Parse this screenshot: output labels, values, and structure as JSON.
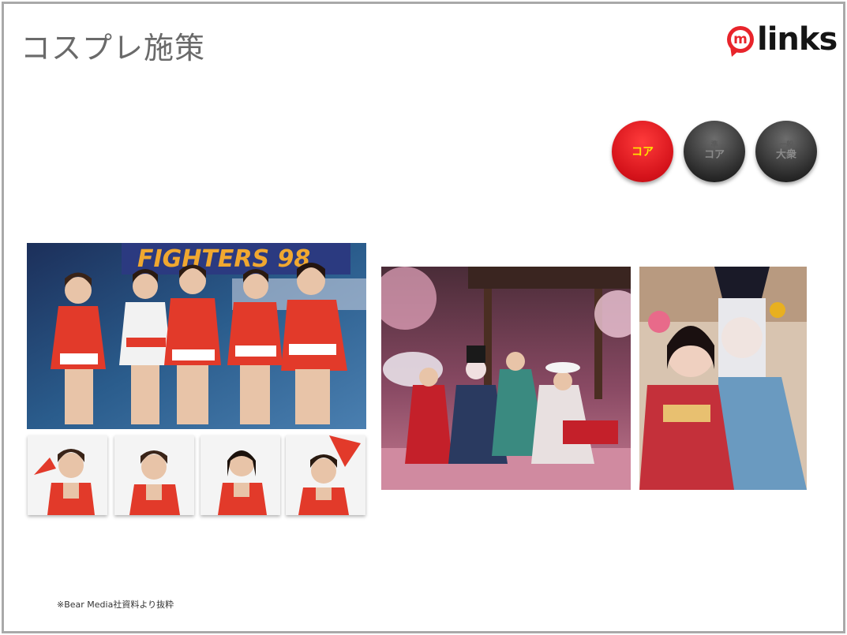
{
  "slide": {
    "title": "コスプレ施策",
    "footnote": "※Bear Media社資料より抜粋"
  },
  "logo": {
    "mark_letter": "m",
    "text": "links",
    "icon": "speech-bubble-m-icon",
    "color": "#e8242b"
  },
  "badges": [
    {
      "label": "コア",
      "sub": "",
      "active": true,
      "color": "#d4121a",
      "text_color": "#ffe600"
    },
    {
      "label": "コア",
      "sub": "準",
      "active": false,
      "color": "#2a2a2a"
    },
    {
      "label": "大衆",
      "sub": "一般",
      "active": false,
      "color": "#2a2a2a"
    }
  ],
  "photos": {
    "group_stage": "group-cosplay-stage-photo",
    "thumbs": [
      "cosplayer-thumb-1",
      "cosplayer-thumb-2",
      "cosplayer-thumb-3",
      "cosplayer-thumb-4"
    ],
    "kimono_group": "kimono-cosplay-group-photo",
    "kimono_pair": "kimono-cosplay-pair-photo"
  }
}
